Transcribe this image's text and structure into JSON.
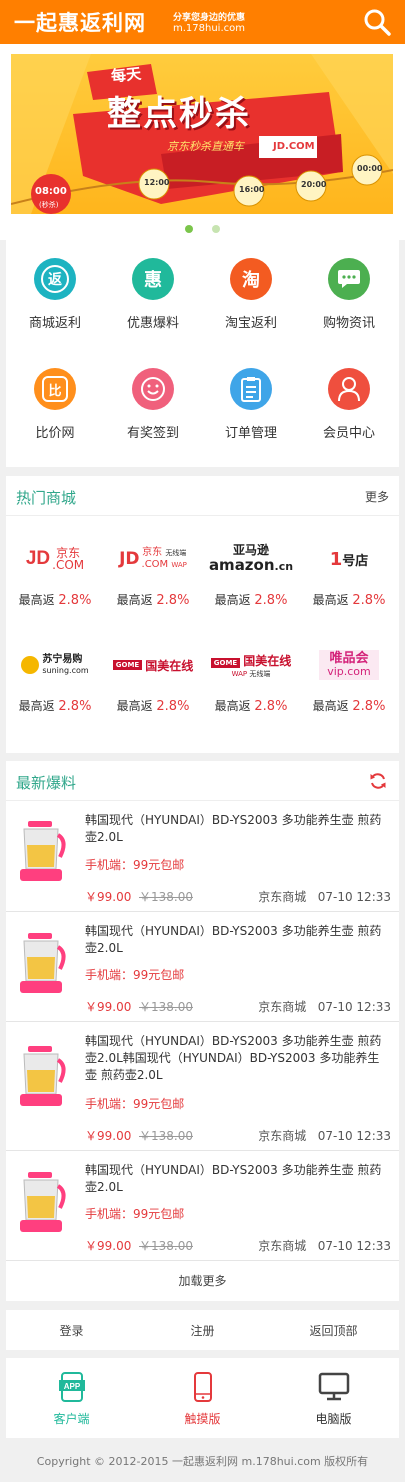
{
  "header": {
    "logo_text": "一起惠返利网",
    "slogan": "分享您身边的优惠",
    "domain": "m.178hui.com",
    "search_icon": "search-icon"
  },
  "banner": {
    "tag_top": "每天",
    "headline": "整点秒杀",
    "subtitle": "京东秒杀直通车",
    "brand": "JD.COM",
    "times": [
      "08:00",
      "12:00",
      "16:00",
      "20:00",
      "00:00"
    ],
    "time_caption": "(秒杀)",
    "slide_count": 2,
    "active_slide": 1
  },
  "quick_nav": [
    {
      "label": "商城返利",
      "icon": "返",
      "color": "#1db3c1"
    },
    {
      "label": "优惠爆料",
      "icon": "惠",
      "color": "#20b99b"
    },
    {
      "label": "淘宝返利",
      "icon": "淘",
      "color": "#f35b21"
    },
    {
      "label": "购物资讯",
      "icon": "chat-icon",
      "color": "#4caf50"
    },
    {
      "label": "比价网",
      "icon": "比",
      "color": "#ff8f1c"
    },
    {
      "label": "有奖签到",
      "icon": "smile-icon",
      "color": "#f0607c"
    },
    {
      "label": "订单管理",
      "icon": "clipboard-icon",
      "color": "#3fa5e8"
    },
    {
      "label": "会员中心",
      "icon": "user-icon",
      "color": "#ef4f3e"
    }
  ],
  "hot_malls": {
    "title": "热门商城",
    "more": "更多",
    "rebate_prefix": "最高返",
    "items": [
      {
        "name": "JD.COM 京东",
        "rebate": "2.8%"
      },
      {
        "name": "JD.COM 京东 WAP 无线端",
        "rebate": "2.8%"
      },
      {
        "name": "亚马逊 amazon.cn",
        "rebate": "2.8%"
      },
      {
        "name": "1号店",
        "rebate": "2.8%"
      },
      {
        "name": "苏宁易购 suning.com",
        "rebate": "2.8%"
      },
      {
        "name": "国美在线",
        "rebate": "2.8%"
      },
      {
        "name": "国美在线 WAP 无线端",
        "rebate": "2.8%"
      },
      {
        "name": "唯品会 vip.com",
        "rebate": "2.8%"
      }
    ]
  },
  "deals": {
    "title": "最新爆料",
    "refresh_icon": "refresh-icon",
    "items": [
      {
        "title": "韩国现代（HYUNDAI）BD-YS2003 多功能养生壶 煎药壶2.0L",
        "tag": "手机端：99元包邮",
        "price": "￥99.00",
        "original": "￥138.00",
        "store": "京东商城",
        "time": "07-10 12:33"
      },
      {
        "title": "韩国现代（HYUNDAI）BD-YS2003 多功能养生壶 煎药壶2.0L",
        "tag": "手机端：99元包邮",
        "price": "￥99.00",
        "original": "￥138.00",
        "store": "京东商城",
        "time": "07-10 12:33"
      },
      {
        "title": "韩国现代（HYUNDAI）BD-YS2003 多功能养生壶 煎药壶2.0L韩国现代（HYUNDAI）BD-YS2003 多功能养生壶 煎药壶2.0L",
        "tag": "手机端：99元包邮",
        "price": "￥99.00",
        "original": "￥138.00",
        "store": "京东商城",
        "time": "07-10 12:33"
      },
      {
        "title": "韩国现代（HYUNDAI）BD-YS2003 多功能养生壶 煎药壶2.0L",
        "tag": "手机端：99元包邮",
        "price": "￥99.00",
        "original": "￥138.00",
        "store": "京东商城",
        "time": "07-10 12:33"
      }
    ],
    "load_more": "加载更多"
  },
  "footer_links": [
    "登录",
    "注册",
    "返回顶部"
  ],
  "versions": [
    {
      "label": "客户端",
      "icon": "app-icon",
      "color": "#20b99b"
    },
    {
      "label": "触摸版",
      "icon": "phone-icon",
      "color": "#e4393c"
    },
    {
      "label": "电脑版",
      "icon": "monitor-icon",
      "color": "#444444"
    }
  ],
  "copyright": "Copyright © 2012-2015 一起惠返利网 m.178hui.com 版权所有"
}
